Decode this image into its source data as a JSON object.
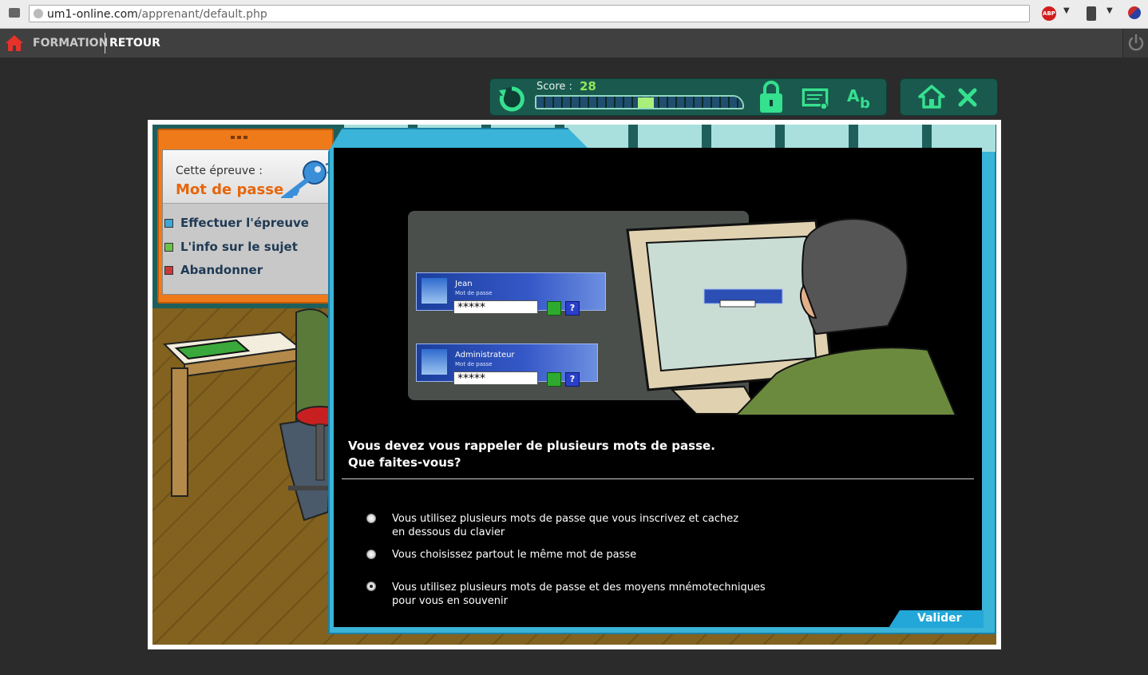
{
  "browser": {
    "url_host": "um1-online.com",
    "url_path": "/apprenant/default.php",
    "abp_label": "ABP"
  },
  "nav": {
    "formation": "FORMATION",
    "retour": "RETOUR"
  },
  "toolbar": {
    "score_label": "Score :",
    "score_value": "28",
    "score_fraction": 0.5
  },
  "mission": {
    "subtitle": "Cette épreuve :",
    "title": "Mot de passe",
    "menu": [
      {
        "label": "Effectuer l'épreuve",
        "color": "#3ea8d8"
      },
      {
        "label": "L'info sur le sujet",
        "color": "#6cc24a"
      },
      {
        "label": "Abandonner",
        "color": "#c83a3a"
      }
    ]
  },
  "illustration": {
    "card1": {
      "name": "Jean",
      "mdp": "Mot de passe",
      "pwd": "*****"
    },
    "card2": {
      "name": "Administrateur",
      "mdp": "Mot de passe",
      "pwd": "*****"
    },
    "help": "?"
  },
  "question": {
    "line1": "Vous devez vous rappeler de plusieurs mots de passe.",
    "line2": "Que faites-vous?"
  },
  "options": [
    {
      "line1": "Vous utilisez plusieurs mots de passe que vous inscrivez et cachez",
      "line2": "en dessous du clavier",
      "checked": false
    },
    {
      "line1": "Vous choisissez partout le même mot de passe",
      "line2": "",
      "checked": false
    },
    {
      "line1": "Vous utilisez plusieurs mots de passe et des moyens mnémotechniques",
      "line2": "pour vous en souvenir",
      "checked": true
    }
  ],
  "valider": "Valider"
}
